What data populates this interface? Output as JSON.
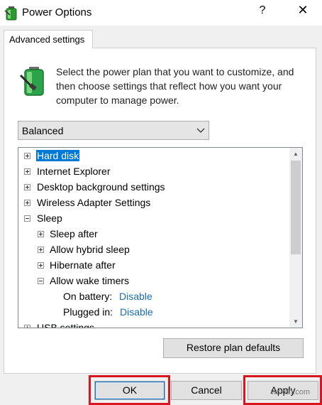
{
  "window": {
    "title": "Power Options",
    "help_label": "?",
    "close_label": "✕"
  },
  "tab": {
    "label": "Advanced settings"
  },
  "intro": {
    "text": "Select the power plan that you want to customize, and then choose settings that reflect how you want your computer to manage power."
  },
  "plan_select": {
    "value": "Balanced"
  },
  "tree": {
    "hard_disk": "Hard disk",
    "internet_explorer": "Internet Explorer",
    "desktop_background": "Desktop background settings",
    "wireless_adapter": "Wireless Adapter Settings",
    "sleep": "Sleep",
    "sleep_after": "Sleep after",
    "hybrid_sleep": "Allow hybrid sleep",
    "hibernate_after": "Hibernate after",
    "wake_timers": "Allow wake timers",
    "on_battery_label": "On battery:",
    "on_battery_value": "Disable",
    "plugged_in_label": "Plugged in:",
    "plugged_in_value": "Disable",
    "usb_settings": "USB settings"
  },
  "buttons": {
    "restore": "Restore plan defaults",
    "ok": "OK",
    "cancel": "Cancel",
    "apply": "Apply"
  },
  "watermark": "wsxdn.com",
  "colors": {
    "accent": "#0078d7",
    "highlight": "#d7161f",
    "link": "#1a6bb0"
  }
}
